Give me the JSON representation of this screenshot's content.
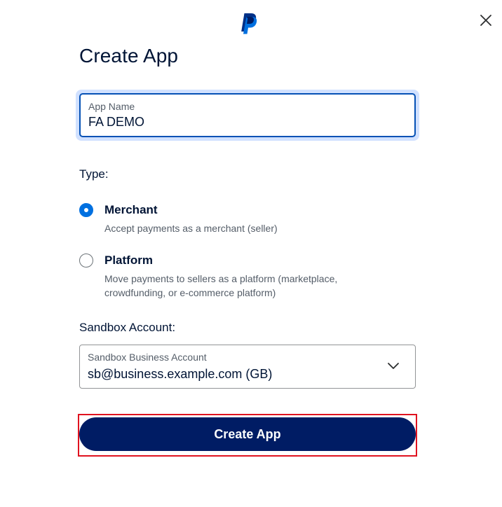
{
  "dialog": {
    "logo_icon": "paypal-logo-icon",
    "close_icon": "close-icon",
    "title": "Create App"
  },
  "app_name": {
    "label": "App Name",
    "value": "FA DEMO"
  },
  "type": {
    "label": "Type:",
    "options": [
      {
        "title": "Merchant",
        "description": "Accept payments as a merchant (seller)",
        "selected": true
      },
      {
        "title": "Platform",
        "description_line1": "Move payments to sellers as a platform (marketplace,",
        "description_line2": "crowdfunding, or e-commerce platform)",
        "selected": false
      }
    ]
  },
  "sandbox": {
    "label": "Sandbox Account:",
    "select_label": "Sandbox Business Account",
    "select_value": "sb@business.example.com (GB)",
    "chevron_icon": "chevron-down-icon"
  },
  "submit": {
    "label": "Create App"
  },
  "colors": {
    "primary_button": "#001c64",
    "focus_border": "#0551b5",
    "radio_selected": "#0070e0",
    "highlight_outline": "#e0121f",
    "text": "#001435",
    "muted_text": "#545d68"
  }
}
